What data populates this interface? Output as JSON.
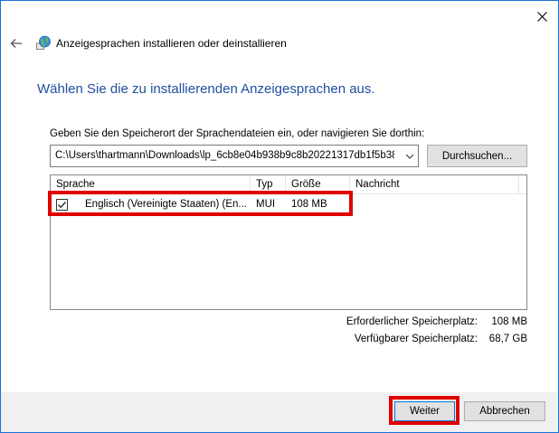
{
  "window": {
    "title": "Anzeigesprachen installieren oder deinstallieren"
  },
  "heading": "Wählen Sie die zu installierenden Anzeigesprachen aus.",
  "path": {
    "label": "Geben Sie den Speicherort der Sprachendateien ein, oder navigieren Sie dorthin:",
    "value": "C:\\Users\\thartmann\\Downloads\\lp_6cb8e04b938b9c8b20221317db1f5b38",
    "browse_label": "Durchsuchen..."
  },
  "list": {
    "columns": [
      "Sprache",
      "Typ",
      "Größe",
      "Nachricht"
    ],
    "rows": [
      {
        "checked": true,
        "language": "Englisch (Vereinigte Staaten) (En...",
        "type": "MUI",
        "size": "108 MB",
        "message": ""
      }
    ]
  },
  "space": {
    "required_label": "Erforderlicher Speicherplatz:",
    "required_value": "108 MB",
    "available_label": "Verfügbarer Speicherplatz:",
    "available_value": "68,7 GB"
  },
  "buttons": {
    "next": "Weiter",
    "cancel": "Abbrechen"
  },
  "colors": {
    "heading": "#1f4e9e",
    "highlight": "#e00000",
    "window_border": "#1a73d9"
  },
  "icons": [
    "close-icon",
    "back-arrow-icon",
    "globe-language-icon",
    "chevron-down-icon",
    "checkmark-icon"
  ]
}
